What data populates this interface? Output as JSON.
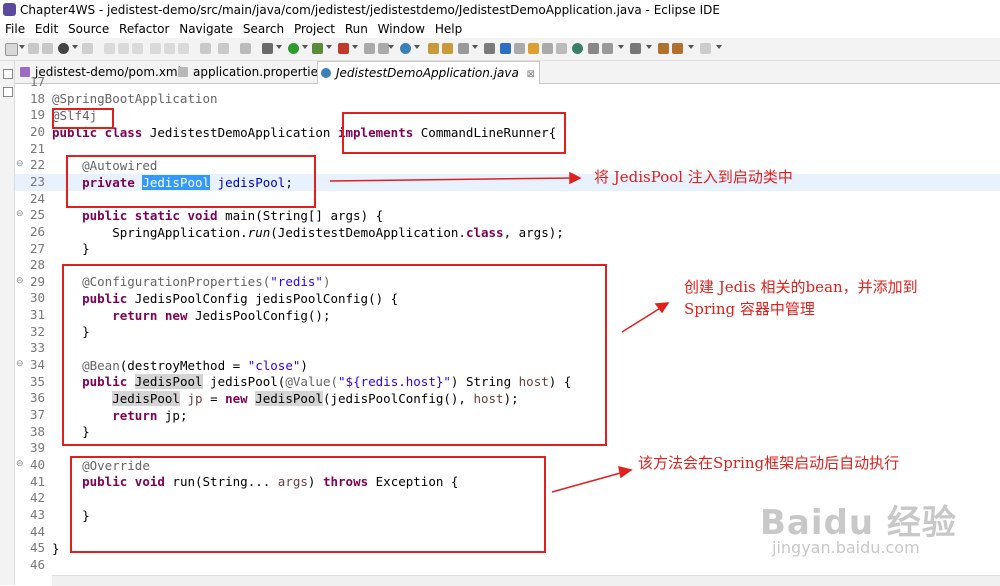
{
  "window": {
    "title": "Chapter4WS - jedistest-demo/src/main/java/com/jedistest/jedistestdemo/JedistestDemoApplication.java - Eclipse IDE"
  },
  "menu": [
    "File",
    "Edit",
    "Source",
    "Refactor",
    "Navigate",
    "Search",
    "Project",
    "Run",
    "Window",
    "Help"
  ],
  "tabs": [
    {
      "label": "jedistest-demo/pom.xml",
      "active": false
    },
    {
      "label": "application.properties",
      "active": false
    },
    {
      "label": "JedistestDemoApplication.java",
      "active": true,
      "close": "⊠"
    }
  ],
  "lines": [
    {
      "n": "17"
    },
    {
      "n": "18"
    },
    {
      "n": "19"
    },
    {
      "n": "20"
    },
    {
      "n": "21"
    },
    {
      "n": "22",
      "fold": "⊖"
    },
    {
      "n": "23"
    },
    {
      "n": "24"
    },
    {
      "n": "25",
      "fold": "⊖"
    },
    {
      "n": "26"
    },
    {
      "n": "27"
    },
    {
      "n": "28"
    },
    {
      "n": "29",
      "fold": "⊖"
    },
    {
      "n": "30"
    },
    {
      "n": "31"
    },
    {
      "n": "32"
    },
    {
      "n": "33"
    },
    {
      "n": "34",
      "fold": "⊖"
    },
    {
      "n": "35"
    },
    {
      "n": "36"
    },
    {
      "n": "37"
    },
    {
      "n": "38"
    },
    {
      "n": "39"
    },
    {
      "n": "40",
      "fold": "⊖"
    },
    {
      "n": "41"
    },
    {
      "n": "42"
    },
    {
      "n": "43"
    },
    {
      "n": "44"
    },
    {
      "n": "45"
    },
    {
      "n": "46"
    }
  ],
  "code": {
    "l18": "@SpringBootApplication",
    "l19": "@Slf4j",
    "l20_a": "public class",
    "l20_b": " JedistestDemoApplication ",
    "l20_c": "implements",
    "l20_d": " CommandLineRunner{",
    "l22": "@Autowired",
    "l23_a": "private",
    "l23_b": "JedisPool",
    "l23_c": "jedisPool",
    "l23_d": ";",
    "l25_a": "public static void",
    "l25_b": " main(String[] args) {",
    "l26_a": "SpringApplication.",
    "l26_b": "run",
    "l26_c": "(JedistestDemoApplication.",
    "l26_d": "class",
    "l26_e": ", args);",
    "l27": "}",
    "l29_a": "@ConfigurationProperties(",
    "l29_b": "\"redis\"",
    "l29_c": ")",
    "l30_a": "public",
    "l30_b": " JedisPoolConfig jedisPoolConfig() {",
    "l31_a": "return new",
    "l31_b": " JedisPoolConfig();",
    "l32": "}",
    "l34_a": "@Bean",
    "l34_b": "(destroyMethod = ",
    "l34_c": "\"close\"",
    "l34_d": ")",
    "l35_a": "public",
    "l35_b": "JedisPool",
    "l35_c": " jedisPool(",
    "l35_d": "@Value(",
    "l35_e": "\"${redis.host}\"",
    "l35_f": ") String ",
    "l35_g": "host",
    "l35_h": ") {",
    "l36_a": "JedisPool",
    "l36_b": "jp",
    "l36_c": " = ",
    "l36_d": "new",
    "l36_e": "JedisPool",
    "l36_f": "(jedisPoolConfig(), ",
    "l36_g": "host",
    "l36_h": ");",
    "l37_a": "return",
    "l37_b": " jp;",
    "l38": "}",
    "l40": "@Override",
    "l41_a": "public void",
    "l41_b": " run(String... ",
    "l41_c": "args",
    "l41_d": ") ",
    "l41_e": "throws",
    "l41_f": " Exception {",
    "l43": "}",
    "l45": "}"
  },
  "annotations": {
    "note1": "将 JedisPool 注入到启动类中",
    "note2_l1": "创建 Jedis 相关的bean，并添加到",
    "note2_l2": "Spring 容器中管理",
    "note3": "该方法会在Spring框架启动后自动执行"
  },
  "watermark": {
    "brand": "Baidu 经验",
    "url": "jingyan.baidu.com"
  },
  "colors": {
    "annotation_red": "#e0201d",
    "keyword": "#7f0055",
    "string": "#2a00ff",
    "current_line": "#e8f2fe"
  }
}
